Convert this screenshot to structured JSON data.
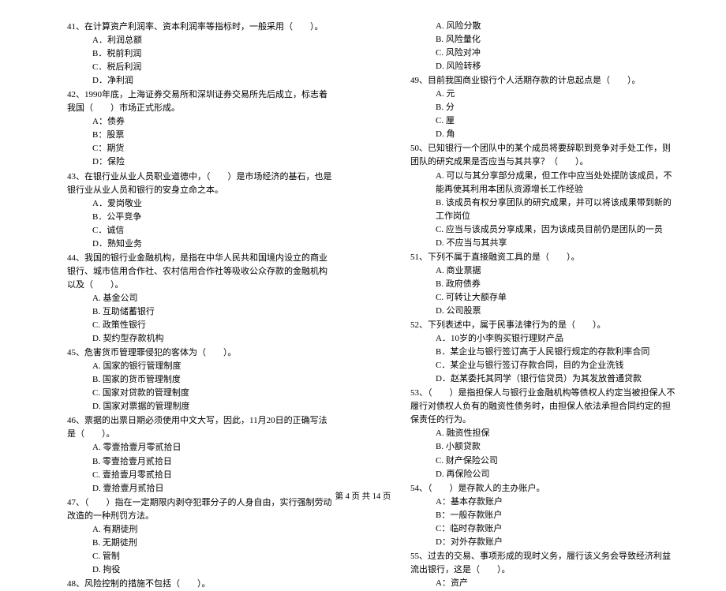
{
  "footer": "第 4 页 共 14 页",
  "left": {
    "q41": {
      "stem": "41、在计算资产利润率、资本利润率等指标时，一般采用（　　）。",
      "a": "A．利润总额",
      "b": "B．税前利润",
      "c": "C．税后利润",
      "d": "D．净利润"
    },
    "q42": {
      "stem": "42、1990年底，上海证券交易所和深圳证券交易所先后成立，标志着我国（　　）市场正式形成。",
      "a": "A：债券",
      "b": "B：股票",
      "c": "C：期货",
      "d": "D：保险"
    },
    "q43": {
      "stem": "43、在银行业从业人员职业道德中，（　　）是市场经济的基石，也是银行业从业人员和银行的安身立命之本。",
      "a": "A．爱岗敬业",
      "b": "B．公平竞争",
      "c": "C．诚信",
      "d": "D．熟知业务"
    },
    "q44": {
      "stem": "44、我国的银行业金融机构，是指在中华人民共和国境内设立的商业银行、城市信用合作社、农村信用合作社等吸收公众存款的金融机构以及（　　）。",
      "a": "A. 基金公司",
      "b": "B. 互助储蓄银行",
      "c": "C. 政策性银行",
      "d": "D. 契约型存款机构"
    },
    "q45": {
      "stem": "45、危害货币管理罪侵犯的客体为（　　）。",
      "a": "A. 国家的银行管理制度",
      "b": "B. 国家的货币管理制度",
      "c": "C. 国家对贷款的管理制度",
      "d": "D. 国家对票据的管理制度"
    },
    "q46": {
      "stem": "46、票据的出票日期必须使用中文大写，因此，11月20日的正确写法是（　　）。",
      "a": "A. 零壹拾壹月零贰拾日",
      "b": "B. 零壹拾壹月贰拾日",
      "c": "C. 壹拾壹月零贰拾日",
      "d": "D. 壹拾壹月贰拾日"
    },
    "q47": {
      "stem": "47、（　　）指在一定期限内剥夺犯罪分子的人身自由，实行强制劳动改造的一种刑罚方法。",
      "a": "A. 有期徒刑",
      "b": "B. 无期徒刑",
      "c": "C. 管制",
      "d": "D. 拘役"
    },
    "q48": {
      "stem": "48、风险控制的措施不包括（　　）。"
    }
  },
  "right": {
    "q48": {
      "a": "A. 风险分散",
      "b": "B. 风险量化",
      "c": "C. 风险对冲",
      "d": "D. 风险转移"
    },
    "q49": {
      "stem": "49、目前我国商业银行个人活期存款的计息起点是（　　）。",
      "a": "A. 元",
      "b": "B. 分",
      "c": "C. 厘",
      "d": "D. 角"
    },
    "q50": {
      "stem": "50、已知银行一个团队中的某个成员将要辞职到竞争对手处工作，则团队的研究成果是否应当与其共享？（　　）。",
      "a": "A. 可以与其分享部分成果，但工作中应当处处提防该成员，不能再使其利用本团队资源增长工作经验",
      "b": "B. 该成员有权分享团队的研究成果，并可以将该成果带到新的工作岗位",
      "c": "C. 应当与该成员分享成果，因为该成员目前仍是团队的一员",
      "d": "D. 不应当与其共享"
    },
    "q51": {
      "stem": "51、下列不属于直接融资工具的是（　　）。",
      "a": "A. 商业票据",
      "b": "B. 政府债券",
      "c": "C. 可转让大额存单",
      "d": "D. 公司股票"
    },
    "q52": {
      "stem": "52、下列表述中，属于民事法律行为的是（　　）。",
      "a": "A．10岁的小李购买银行理财产品",
      "b": "B．某企业与银行签订高于人民银行规定的存款利率合同",
      "c": "C．某企业与银行签订存款合同，目的为企业洗钱",
      "d": "D．赵某委托其同学（银行信贷员）为其发放普通贷款"
    },
    "q53": {
      "stem": "53、（　　）是指担保人与银行业金融机构等债权人约定当被担保人不履行对债权人负有的融资性债务时，由担保人依法承担合同约定的担保责任的行为。",
      "a": "A. 融资性担保",
      "b": "B. 小额贷款",
      "c": "C. 财产保险公司",
      "d": "D. 再保险公司"
    },
    "q54": {
      "stem": "54、（　　）是存款人的主办账户。",
      "a": "A：基本存款账户",
      "b": "B：一般存款账户",
      "c": "C：临时存款账户",
      "d": "D：对外存款账户"
    },
    "q55": {
      "stem": "55、过去的交易、事项形成的现时义务，履行该义务会导致经济利益流出银行，这是（　　）。",
      "a": "A：资产"
    }
  }
}
